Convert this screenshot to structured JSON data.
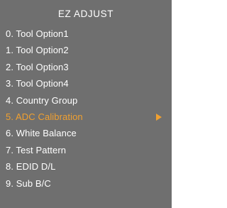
{
  "menu": {
    "title": "EZ  ADJUST",
    "items": [
      {
        "label": "0.  Tool Option1"
      },
      {
        "label": "1.  Tool Option2"
      },
      {
        "label": "2.  Tool Option3"
      },
      {
        "label": "3.  Tool Option4"
      },
      {
        "label": "4.  Country Group"
      },
      {
        "label": "5.  ADC Calibration"
      },
      {
        "label": "6.  White Balance"
      },
      {
        "label": "7.  Test Pattern"
      },
      {
        "label": "8.  EDID D/L"
      },
      {
        "label": "9.  Sub B/C"
      }
    ],
    "selected_index": 5,
    "submenu_arrow_icon": "right-triangle-arrow-icon"
  },
  "colors": {
    "background": "#6f6f6f",
    "text": "#ffffff",
    "highlight": "#f0a030"
  }
}
